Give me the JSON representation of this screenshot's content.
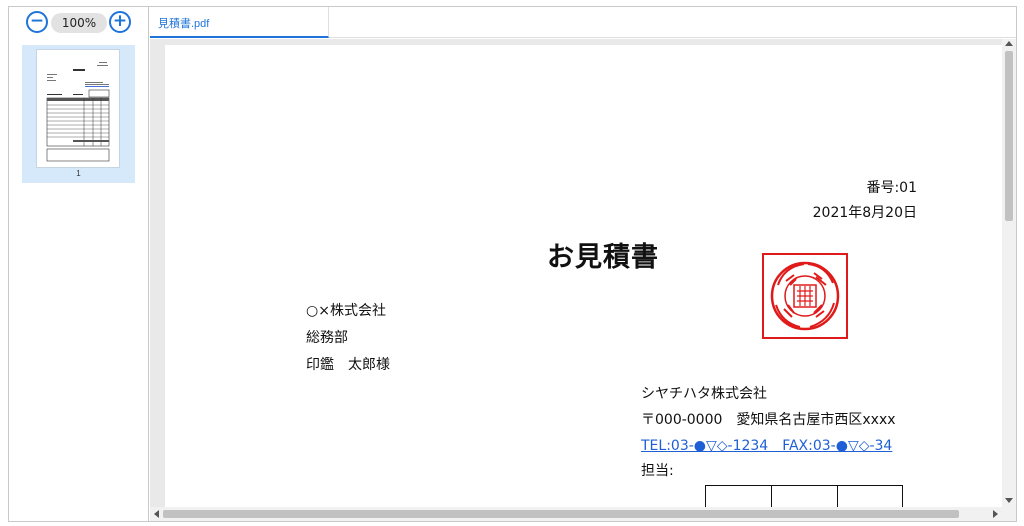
{
  "colors": {
    "accent": "#1f74d9",
    "thumbnail_selected_bg": "#d6e9fb",
    "seal_red": "#e01a1a",
    "link_blue": "#1f5fd6",
    "viewer_bg": "#e9e9e9"
  },
  "toolbar": {
    "zoom_out_icon": "zoom-out-icon",
    "zoom_level": "100%",
    "zoom_in_icon": "zoom-in-icon"
  },
  "thumbnails": [
    {
      "page_label": "1",
      "selected": true
    }
  ],
  "tabs": [
    {
      "label": "見積書.pdf",
      "active": true
    }
  ],
  "document": {
    "number": "番号:01",
    "date": "2021年8月20日",
    "title": "お見積書",
    "recipient": {
      "company": "○×株式会社",
      "department": "総務部",
      "person": "印鑑　太郎様"
    },
    "issuer": {
      "company": "シヤチハタ株式会社",
      "address": "〒000-0000　愛知県名古屋市西区xxxx",
      "contact": "TEL:03-●▽◇-1234　FAX:03-●▽◇-34",
      "staff": "担当:"
    },
    "seal_icon": "company-seal-icon"
  }
}
